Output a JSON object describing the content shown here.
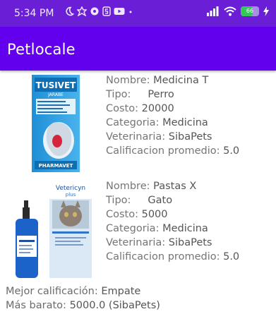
{
  "status_bar": {
    "time": "5:34 PM",
    "notification_icons": [
      "moon-icon",
      "photos-icon",
      "gear-icon",
      "s-icon",
      "youtube-icon",
      "dot-icon"
    ],
    "battery_level": "66",
    "battery_fraction": 0.66
  },
  "app_bar": {
    "title": "Petlocale"
  },
  "products": [
    {
      "image_name": "tusivet-product-image",
      "image_brand": "TUSIVET",
      "image_sub": "JARABE",
      "image_footer": "PHARMAVET",
      "nombre_label": "Nombre: ",
      "nombre": "Medicina T",
      "tipo_label": "Tipo:",
      "tipo": "Perro",
      "costo_label": "Costo: ",
      "costo": "20000",
      "categoria_label": "Categoria: ",
      "categoria": "Medicina",
      "veterinaria_label": "Veterinaria: ",
      "veterinaria": "SibaPets",
      "calificacion_label": "Calificacion promedio: ",
      "calificacion": "5.0"
    },
    {
      "image_name": "vetericyn-product-image",
      "image_brand": "Vetericyn",
      "image_sub": "plus",
      "image_footer": "",
      "nombre_label": "Nombre: ",
      "nombre": "Pastas X",
      "tipo_label": "Tipo:",
      "tipo": "Gato",
      "costo_label": "Costo: ",
      "costo": "5000",
      "categoria_label": "Categoria: ",
      "categoria": "Medicina",
      "veterinaria_label": "Veterinaria: ",
      "veterinaria": "SibaPets",
      "calificacion_label": "Calificacion promedio: ",
      "calificacion": "5.0"
    }
  ],
  "summary": {
    "mejor_label": "Mejor calificación: ",
    "mejor": "Empate",
    "barato_label": "Más barato: ",
    "barato": "5000.0 (SibaPets)"
  },
  "colors": {
    "status_bar": "#6a1fd6",
    "app_bar": "#6200ee",
    "text": "#6b6b6b"
  }
}
